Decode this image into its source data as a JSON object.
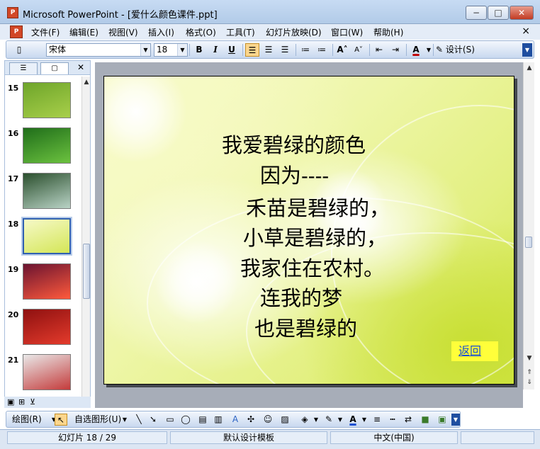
{
  "window": {
    "title": "Microsoft PowerPoint - [爱什么颜色课件.ppt]",
    "app_icon": "powerpoint-icon",
    "buttons": {
      "minimize": "−",
      "maximize": "□",
      "close": "✕"
    }
  },
  "menu": {
    "items": [
      "文件(F)",
      "编辑(E)",
      "视图(V)",
      "插入(I)",
      "格式(O)",
      "工具(T)",
      "幻灯片放映(D)",
      "窗口(W)",
      "帮助(H)"
    ],
    "close": "×"
  },
  "toolbar": {
    "font_name": "宋体",
    "font_size": "18",
    "bold": "B",
    "italic": "I",
    "underline": "U",
    "font_color_label": "A",
    "design_label": "设计(S)"
  },
  "slides_panel": {
    "thumbnails": [
      {
        "number": "15",
        "colors": [
          "#6ea52a",
          "#a8cf4a"
        ]
      },
      {
        "number": "16",
        "colors": [
          "#1f6d1a",
          "#6cc23f"
        ]
      },
      {
        "number": "17",
        "colors": [
          "#2b4f2d",
          "#b9d3c6"
        ]
      },
      {
        "number": "18",
        "colors": [
          "#f6f9c8",
          "#d4e657"
        ]
      },
      {
        "number": "19",
        "colors": [
          "#6a1330",
          "#ff5a3c"
        ]
      },
      {
        "number": "20",
        "colors": [
          "#8e1010",
          "#e43b2c"
        ]
      },
      {
        "number": "21",
        "colors": [
          "#e9e9e9",
          "#c43b3b"
        ]
      }
    ],
    "selected_index": 3
  },
  "slide": {
    "lines": [
      "我爱碧绿的颜色",
      "因为----",
      "禾苗是碧绿的，",
      "小草是碧绿的，",
      "我家住在农村。",
      "连我的梦",
      "也是碧绿的"
    ],
    "back_link": "返回"
  },
  "drawing_toolbar": {
    "draw_label": "绘图(R)",
    "autoshapes_label": "自选图形(U)"
  },
  "status": {
    "slide_position": "幻灯片 18 / 29",
    "template": "默认设计模板",
    "language": "中文(中国)"
  },
  "colors": {
    "accent": "#3060b0",
    "link_bg": "#ffff3a",
    "link": "#1a4fd0"
  }
}
